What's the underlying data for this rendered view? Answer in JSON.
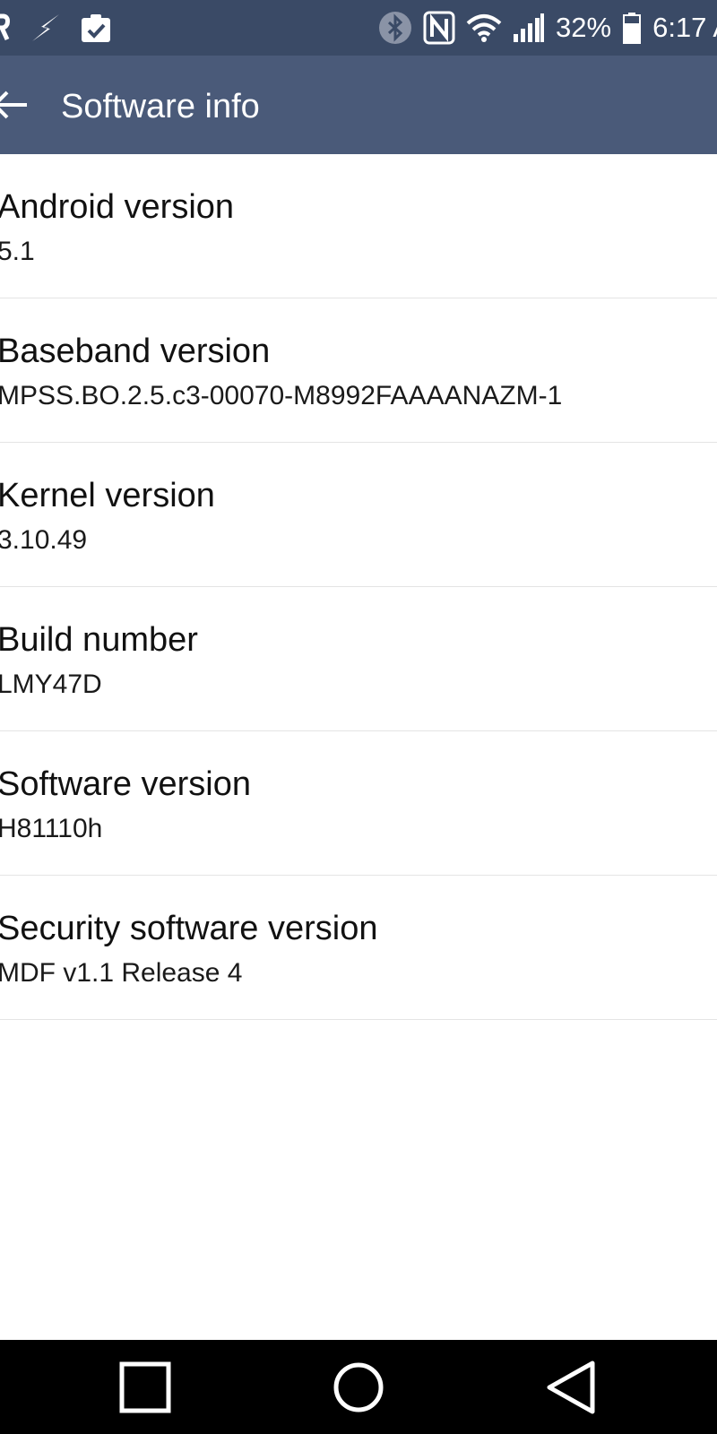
{
  "status_bar": {
    "battery": "32%",
    "time": "6:17 A",
    "icons": [
      "notification-person-icon",
      "flash-icon",
      "clipboard-check-icon",
      "bluetooth-icon",
      "nfc-icon",
      "wifi-icon",
      "signal-icon",
      "battery-icon"
    ]
  },
  "app_bar": {
    "title": "Software info",
    "back_icon": "back-arrow-icon"
  },
  "items": [
    {
      "title": "Android version",
      "value": "5.1"
    },
    {
      "title": "Baseband version",
      "value": "MPSS.BO.2.5.c3-00070-M8992FAAAANAZM-1"
    },
    {
      "title": "Kernel version",
      "value": "3.10.49"
    },
    {
      "title": "Build number",
      "value": "LMY47D"
    },
    {
      "title": "Software version",
      "value": "H81110h"
    },
    {
      "title": "Security software version",
      "value": "MDF v1.1 Release 4"
    }
  ],
  "nav_bar": {
    "buttons": [
      "recents-square-icon",
      "home-circle-icon",
      "back-triangle-icon"
    ]
  },
  "colors": {
    "status_bar": "#3a4a66",
    "app_bar": "#4a5a79",
    "nav_bar": "#000000"
  }
}
